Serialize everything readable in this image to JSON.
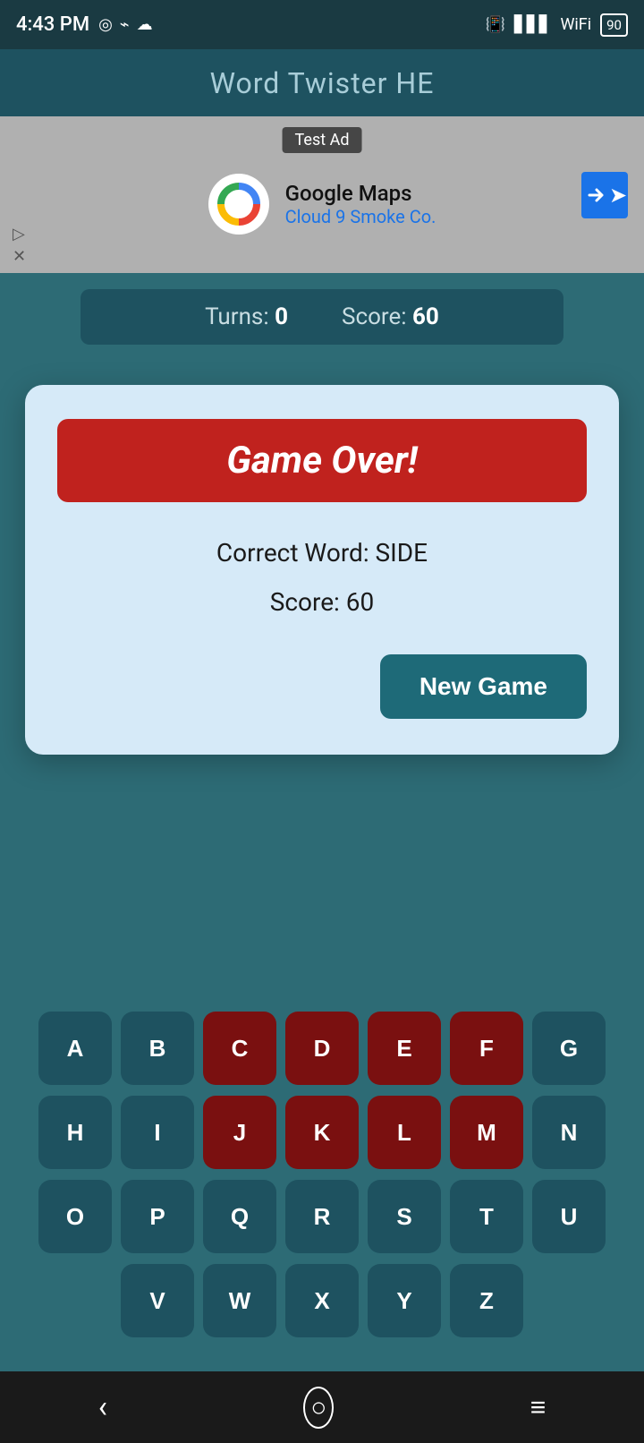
{
  "statusBar": {
    "time": "4:43 PM",
    "battery": "90"
  },
  "appTitle": "Word Twister HE",
  "ad": {
    "label": "Test Ad",
    "companyName": "Google Maps",
    "subtitle": "Cloud 9 Smoke Co."
  },
  "scoreBar": {
    "turnsLabel": "Turns:",
    "turnsValue": "0",
    "scoreLabel": "Score:",
    "scoreValue": "60"
  },
  "modal": {
    "gameOverLabel": "Game Over!",
    "correctWordLabel": "Correct Word: SIDE",
    "scoreLabel": "Score: 60",
    "newGameLabel": "New Game"
  },
  "keyboard": {
    "rows": [
      [
        "A",
        "B",
        "C",
        "D",
        "E",
        "F",
        "G"
      ],
      [
        "H",
        "I",
        "J",
        "K",
        "L",
        "M",
        "N"
      ],
      [
        "O",
        "P",
        "Q",
        "R",
        "S",
        "T",
        "U"
      ],
      [
        "V",
        "W",
        "X",
        "Y",
        "Z"
      ]
    ],
    "usedKeys": [
      "C",
      "D",
      "E",
      "F",
      "J",
      "K",
      "L",
      "M"
    ]
  },
  "navBar": {
    "backIcon": "‹",
    "homeIcon": "○",
    "menuIcon": "≡"
  }
}
